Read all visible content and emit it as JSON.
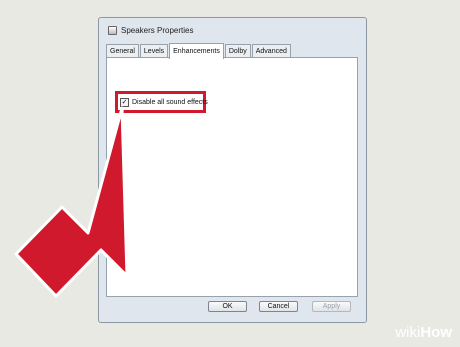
{
  "window": {
    "title": "Speakers Properties"
  },
  "tabs": [
    {
      "label": "General"
    },
    {
      "label": "Levels"
    },
    {
      "label": "Enhancements"
    },
    {
      "label": "Dolby"
    },
    {
      "label": "Advanced"
    }
  ],
  "active_tab": "Enhancements",
  "enhancements": {
    "disable_effects_label": "Disable all sound effects",
    "disable_effects_checked": true,
    "check_glyph": "✓"
  },
  "buttons": {
    "ok": "OK",
    "cancel": "Cancel",
    "apply": "Apply"
  },
  "watermark": {
    "part1": "wiki",
    "part2": "How"
  },
  "colors": {
    "highlight": "#d1192e",
    "arrow": "#d1192e"
  }
}
